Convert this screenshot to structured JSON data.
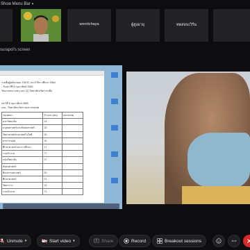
{
  "menu_toggle": {
    "label": "Show Menu Bar",
    "caret": "▾"
  },
  "participants": [
    {
      "name": ""
    },
    {
      "name": ""
    },
    {
      "name": "werotchaya"
    },
    {
      "name": "ผู้สูงอายุ"
    },
    {
      "name": "ทดสอบเวิร์น"
    },
    {
      "name": ""
    }
  ],
  "share_label": "surapol's screen",
  "document": {
    "lines": [
      "รายชื่อผู้สมัครสอบ TOEIC ประจำปีการศึกษา 2564",
      "- วันเสาร์ที่ 5 กุมภาพันธ์ 2565",
      "วิทยาเขตบางเขน และ (2) วิทยาลัยนวัตกรรมสื่อ"
    ],
    "section_title": "เสาร์ที่ 5 กุมภาพันธ์ 2565",
    "section_sub": "เขน - วิทยาลัยนวัตกรรมสารสนเทศ",
    "table_header": [
      "กลุ่มคณะ",
      "จำนวน (คน)",
      "หมายเหตุ"
    ],
    "table_rows": [
      [
        "มหาวิทยาลัย",
        "13",
        ""
      ],
      [
        "มนุษยศาสตร์และสังคมศาสตร์",
        "13",
        ""
      ],
      [
        "วิทยาศาสตร์และเทคโนโลยี",
        "15",
        ""
      ],
      [
        "สาธารณสุข",
        "19",
        ""
      ],
      [
        "ศึกษาศาสตร์และการศึกษา",
        "17",
        ""
      ],
      [
        "รวมจำนวน",
        "77",
        ""
      ],
      [
        "กลุ่มวิทยาลัย",
        "17",
        ""
      ],
      [
        "สังคมศาสตร์",
        "",
        ""
      ],
      [
        "ศิลปกรรมศาสตร์",
        "20",
        ""
      ],
      [
        "ศึกษาศาสตร์",
        "21",
        ""
      ],
      [
        "วิทยาการ",
        "13",
        ""
      ],
      [
        "รวมจำนวน",
        "71",
        ""
      ]
    ]
  },
  "toolbar": {
    "unmute": "Unmute",
    "start_video": "Start video",
    "share": "Share",
    "record": "Record",
    "breakout": "Breakout sessions"
  }
}
